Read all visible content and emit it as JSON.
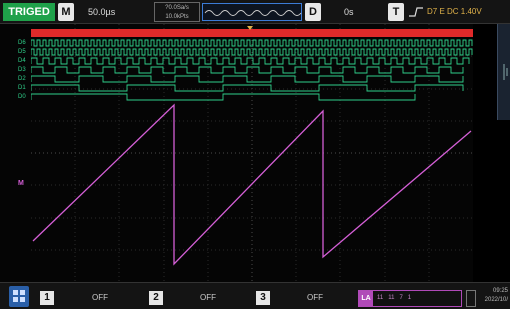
{
  "topbar": {
    "trigger_status": "TRIGED",
    "timebase_tag": "M",
    "timebase_value": "50.0µs",
    "sample_rate": "?0.0Sa/s",
    "memory_depth": "10.0kPts",
    "delay_tag": "D",
    "delay_value": "0s",
    "trigger_tag": "T",
    "trigger_summary": "D7 E DC 1.40V"
  },
  "left": {
    "digital_labels": [
      "D6",
      "D5",
      "D4",
      "D3",
      "D2",
      "D1",
      "D0"
    ],
    "analog_marker": "M"
  },
  "bottombar": {
    "channels": [
      {
        "num": "1",
        "status": "OFF"
      },
      {
        "num": "2",
        "status": "OFF"
      },
      {
        "num": "3",
        "status": "OFF"
      }
    ],
    "la_tag": "LA",
    "la_codes": "11   11   7   1",
    "clock_time": "09:25",
    "clock_date": "2022/10/"
  },
  "colors": {
    "trig_green": "#1fa14a",
    "bus_red": "#e02a2a",
    "digital_green": "#2fd08a",
    "analog_magenta": "#d45fd6",
    "la_purple": "#b04ab8",
    "delay_blue": "#3b7bd6"
  }
}
